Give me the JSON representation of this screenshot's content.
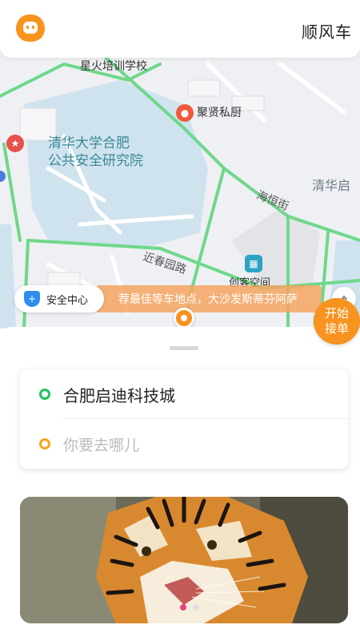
{
  "header": {
    "title": "顺风车",
    "avatar_icon": "orange-avatar-icon"
  },
  "map": {
    "labels": {
      "campus": "清华大学合肥",
      "campus2": "公共安全研究院",
      "school": "星火培训学校",
      "restaurant": "聚贤私厨",
      "haiheng": "海恒街",
      "jinchun": "近春园路",
      "qinghua": "清华启",
      "chuangke": "创客空间"
    },
    "safety_center": "安全中心",
    "notice": "荐最佳等车地点，大沙发斯蒂芬阿萨",
    "start_order": {
      "line1": "开始",
      "line2": "接单"
    }
  },
  "route": {
    "from": "合肥启迪科技城",
    "to_placeholder": "你要去哪儿"
  },
  "banner": {
    "image": "tiger-photo",
    "dots": 2,
    "active_dot": 0
  },
  "colors": {
    "brand": "#f7931e",
    "green": "#1fc25a",
    "road": "#6fd88a"
  }
}
